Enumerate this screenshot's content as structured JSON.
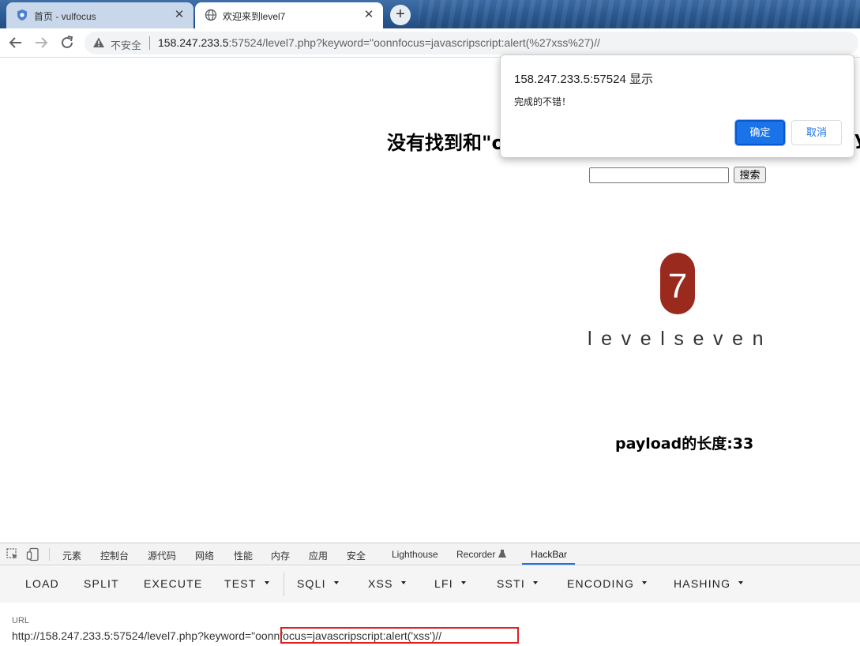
{
  "browser": {
    "tabs": [
      {
        "title": "首页 - vulfocus",
        "icon": "shield-icon",
        "active": false
      },
      {
        "title": "欢迎来到level7",
        "icon": "globe-icon",
        "active": true
      }
    ],
    "close_glyph": "✕",
    "new_tab_glyph": "+",
    "address_bar": {
      "security_label": "不安全",
      "url_host": "158.247.233.5",
      "url_rest": ":57524/level7.php?keyword=\"oonnfocus=javascripscript:alert(%27xss%27)//"
    }
  },
  "page": {
    "heading": "没有找到和\"o",
    "heading_tail": "y",
    "search_button": "搜索",
    "search_value": "",
    "logo_digit": "7",
    "logo_text": "levelseven",
    "payload_length": "payload的长度:33"
  },
  "alert_dialog": {
    "title": "158.247.233.5:57524 显示",
    "message": "完成的不错！",
    "ok_label": "确定",
    "cancel_label": "取消"
  },
  "devtools": {
    "tabs": [
      "元素",
      "控制台",
      "源代码",
      "网络",
      "性能",
      "内存",
      "应用",
      "安全",
      "Lighthouse",
      "Recorder",
      "HackBar"
    ],
    "active_tab": "HackBar",
    "hackbar_buttons": [
      {
        "label": "LOAD",
        "dropdown": false
      },
      {
        "label": "SPLIT",
        "dropdown": false
      },
      {
        "label": "EXECUTE",
        "dropdown": false
      },
      {
        "label": "TEST",
        "dropdown": true
      },
      {
        "label": "SQLI",
        "dropdown": true
      },
      {
        "label": "XSS",
        "dropdown": true
      },
      {
        "label": "LFI",
        "dropdown": true
      },
      {
        "label": "SSTI",
        "dropdown": true
      },
      {
        "label": "ENCODING",
        "dropdown": true
      },
      {
        "label": "HASHING",
        "dropdown": true
      }
    ],
    "url_label": "URL",
    "url_value": "http://158.247.233.5:57524/level7.php?keyword=\"oonnfocus=javascripscript:alert('xss')//"
  },
  "colors": {
    "accent": "#1a73e8",
    "logo_red": "#9b2a1e",
    "highlight_box": "#e02020"
  }
}
